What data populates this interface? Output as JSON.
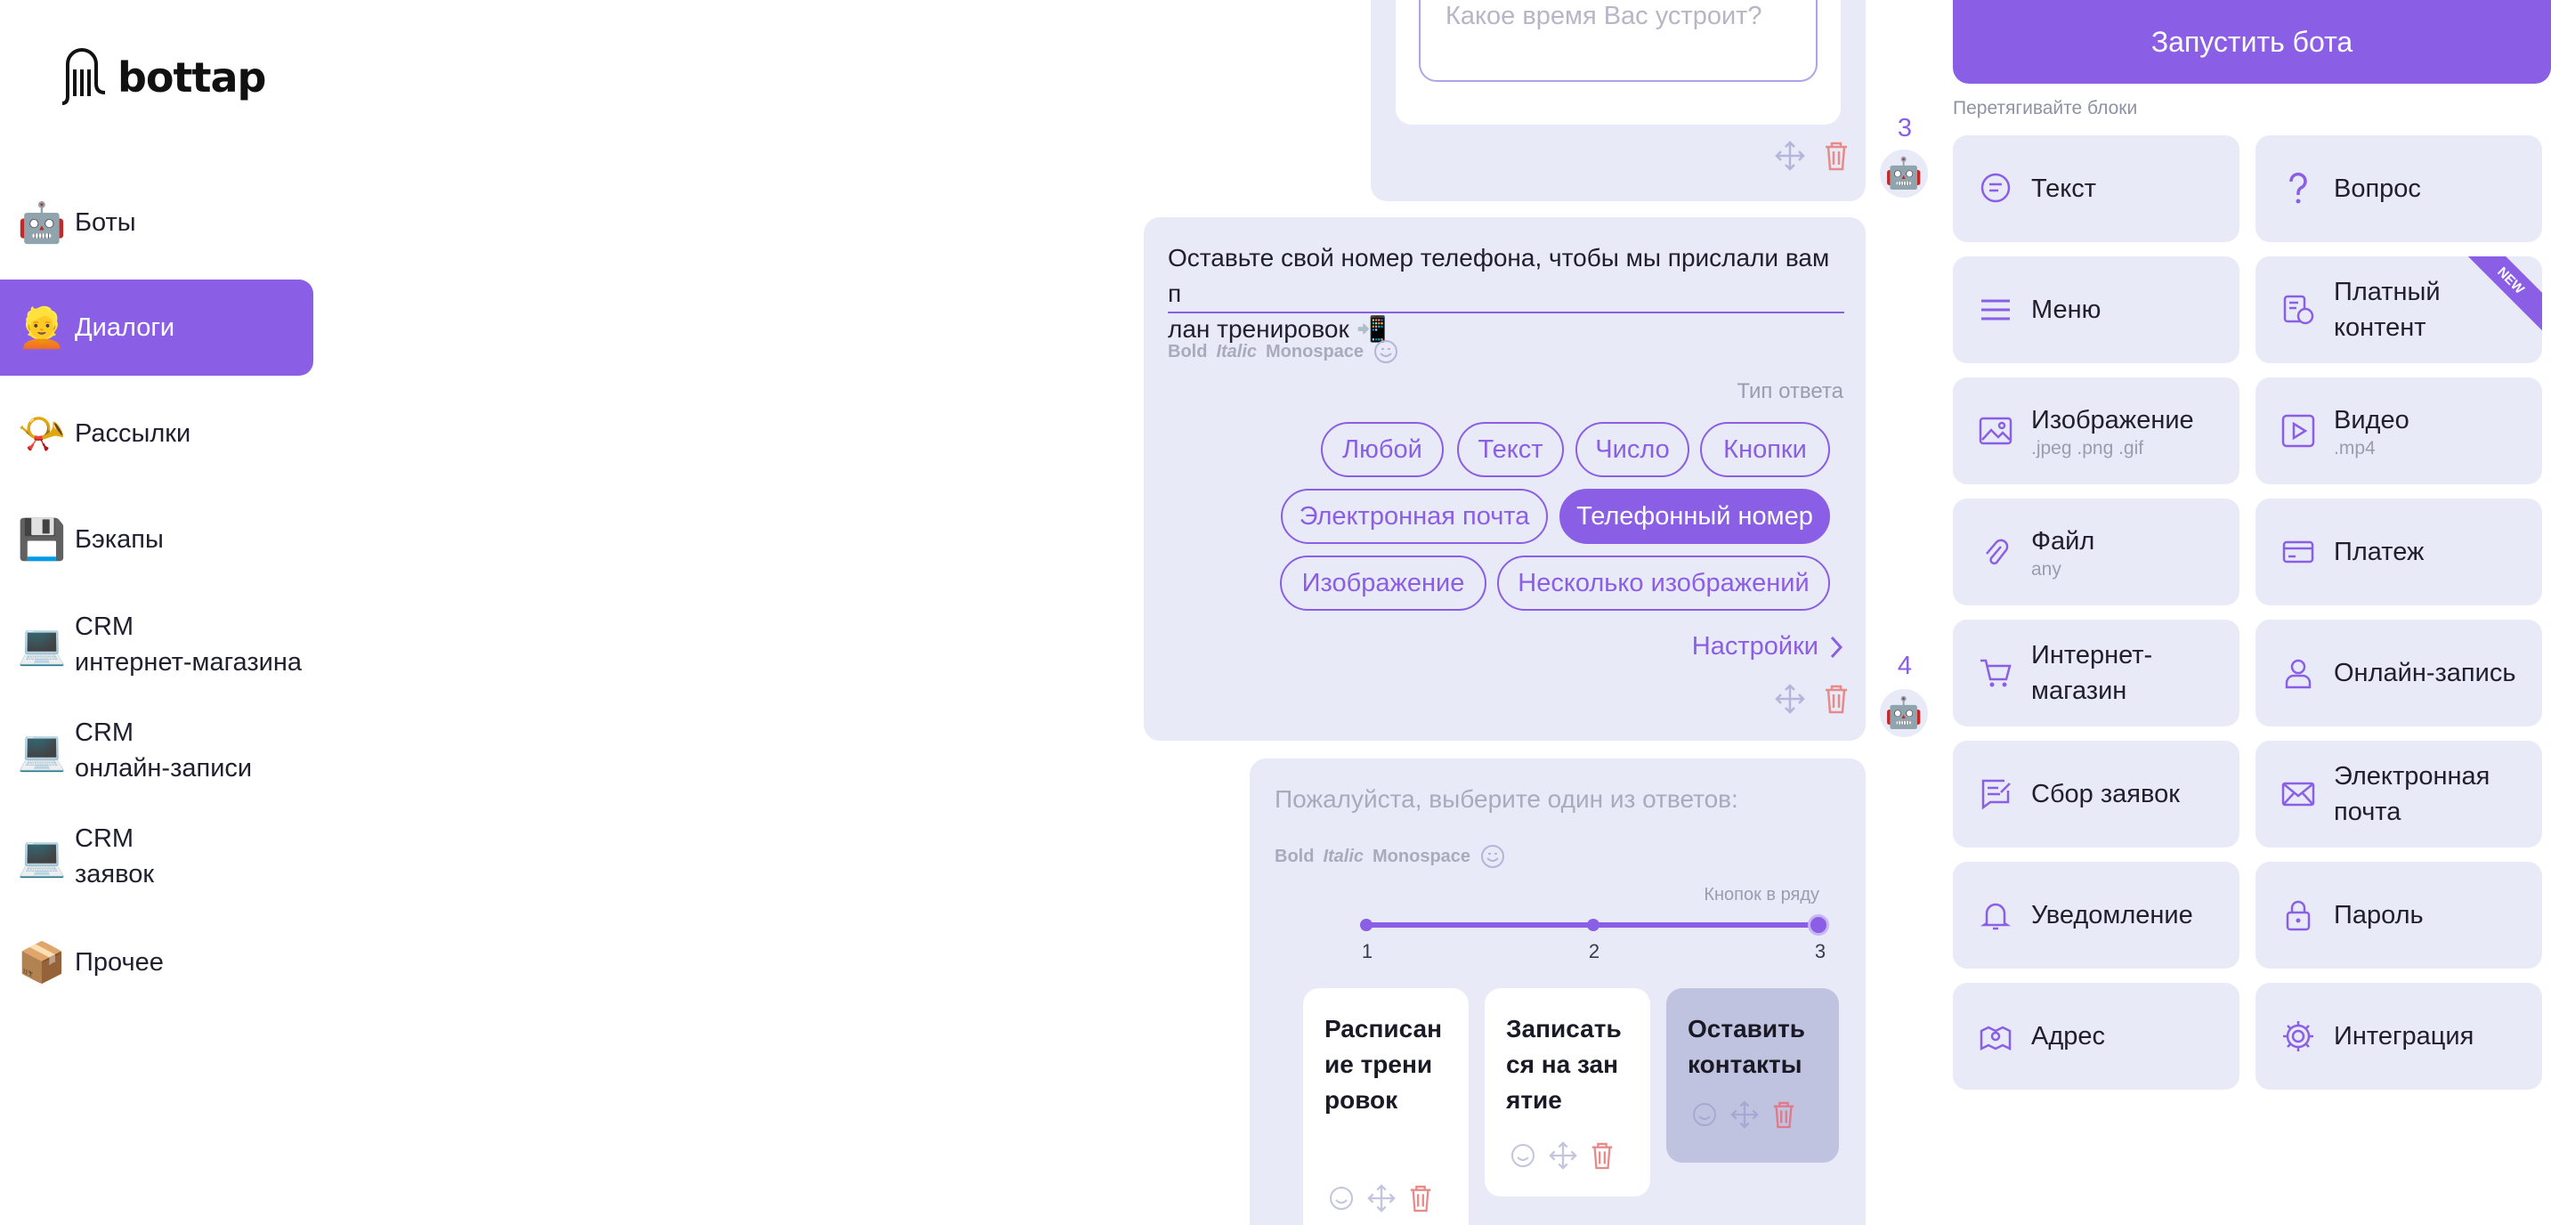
{
  "brand": {
    "name": "bottap"
  },
  "sidebar": {
    "items": [
      {
        "label": "Боты",
        "emoji": "🤖"
      },
      {
        "label": "Диалоги",
        "emoji": "👱",
        "active": true
      },
      {
        "label": "Рассылки",
        "emoji": "📯"
      },
      {
        "label": "Бэкапы",
        "emoji": "💾"
      },
      {
        "label_line1": "CRM",
        "label_line2": "интернет-магазина",
        "emoji": "💻"
      },
      {
        "label_line1": "CRM",
        "label_line2": "онлайн-записи",
        "emoji": "💻"
      },
      {
        "label_line1": "CRM",
        "label_line2": "заявок",
        "emoji": "💻"
      },
      {
        "label": "Прочее",
        "emoji": "📦"
      }
    ]
  },
  "editor": {
    "step_prev": {
      "placeholder": "Какое время Вас устроит?",
      "step_number": "3"
    },
    "step_phone": {
      "step_number": "4",
      "message_line1": "Оставьте свой номер телефона, чтобы мы прислали вам п",
      "message_line2": "лан тренировок 📲",
      "format_bold": "Bold",
      "format_italic": "Italic",
      "format_mono": "Monospace",
      "answer_type_label": "Тип ответа",
      "answer_types": [
        "Любой",
        "Текст",
        "Число",
        "Кнопки",
        "Электронная почта",
        "Телефонный номер",
        "Изображение",
        "Несколько изображений"
      ],
      "selected_answer_type": "Телефонный номер",
      "settings_label": "Настройки"
    },
    "step_menu": {
      "placeholder": "Пожалуйста, выберите один из ответов:",
      "format_bold": "Bold",
      "format_italic": "Italic",
      "format_mono": "Monospace",
      "buttons_per_row_label": "Кнопок в ряду",
      "slider_ticks": [
        "1",
        "2",
        "3"
      ],
      "buttons_per_row": 3,
      "buttons": [
        "Расписание тренировок",
        "Записаться на занятие",
        "Оставить контакты"
      ]
    }
  },
  "palette": {
    "launch_label": "Запустить бота",
    "hint": "Перетягивайте блоки",
    "new_badge": "NEW",
    "blocks": [
      {
        "title": "Текст",
        "icon": "chat-bubble-icon"
      },
      {
        "title": "Вопрос",
        "icon": "question-icon"
      },
      {
        "title": "Меню",
        "icon": "menu-icon"
      },
      {
        "title": "Платный контент",
        "icon": "paid-content-icon",
        "badge": true
      },
      {
        "title": "Изображение",
        "sub": ".jpeg .png .gif",
        "icon": "image-icon"
      },
      {
        "title": "Видео",
        "sub": ".mp4",
        "icon": "video-icon"
      },
      {
        "title": "Файл",
        "sub": "any",
        "icon": "paperclip-icon"
      },
      {
        "title": "Платеж",
        "icon": "card-icon"
      },
      {
        "title": "Интернет-магазин",
        "icon": "cart-icon"
      },
      {
        "title": "Онлайн-запись",
        "icon": "person-icon"
      },
      {
        "title": "Сбор заявок",
        "icon": "form-icon"
      },
      {
        "title": "Электронная почта",
        "icon": "mail-icon"
      },
      {
        "title": "Уведомление",
        "icon": "bell-icon"
      },
      {
        "title": "Пароль",
        "icon": "lock-icon"
      },
      {
        "title": "Адрес",
        "icon": "location-icon"
      },
      {
        "title": "Интеграция",
        "icon": "gear-icon"
      }
    ]
  },
  "colors": {
    "accent": "#8b5ee6",
    "card": "#e8eaf8",
    "trash": "#e88a8a"
  }
}
